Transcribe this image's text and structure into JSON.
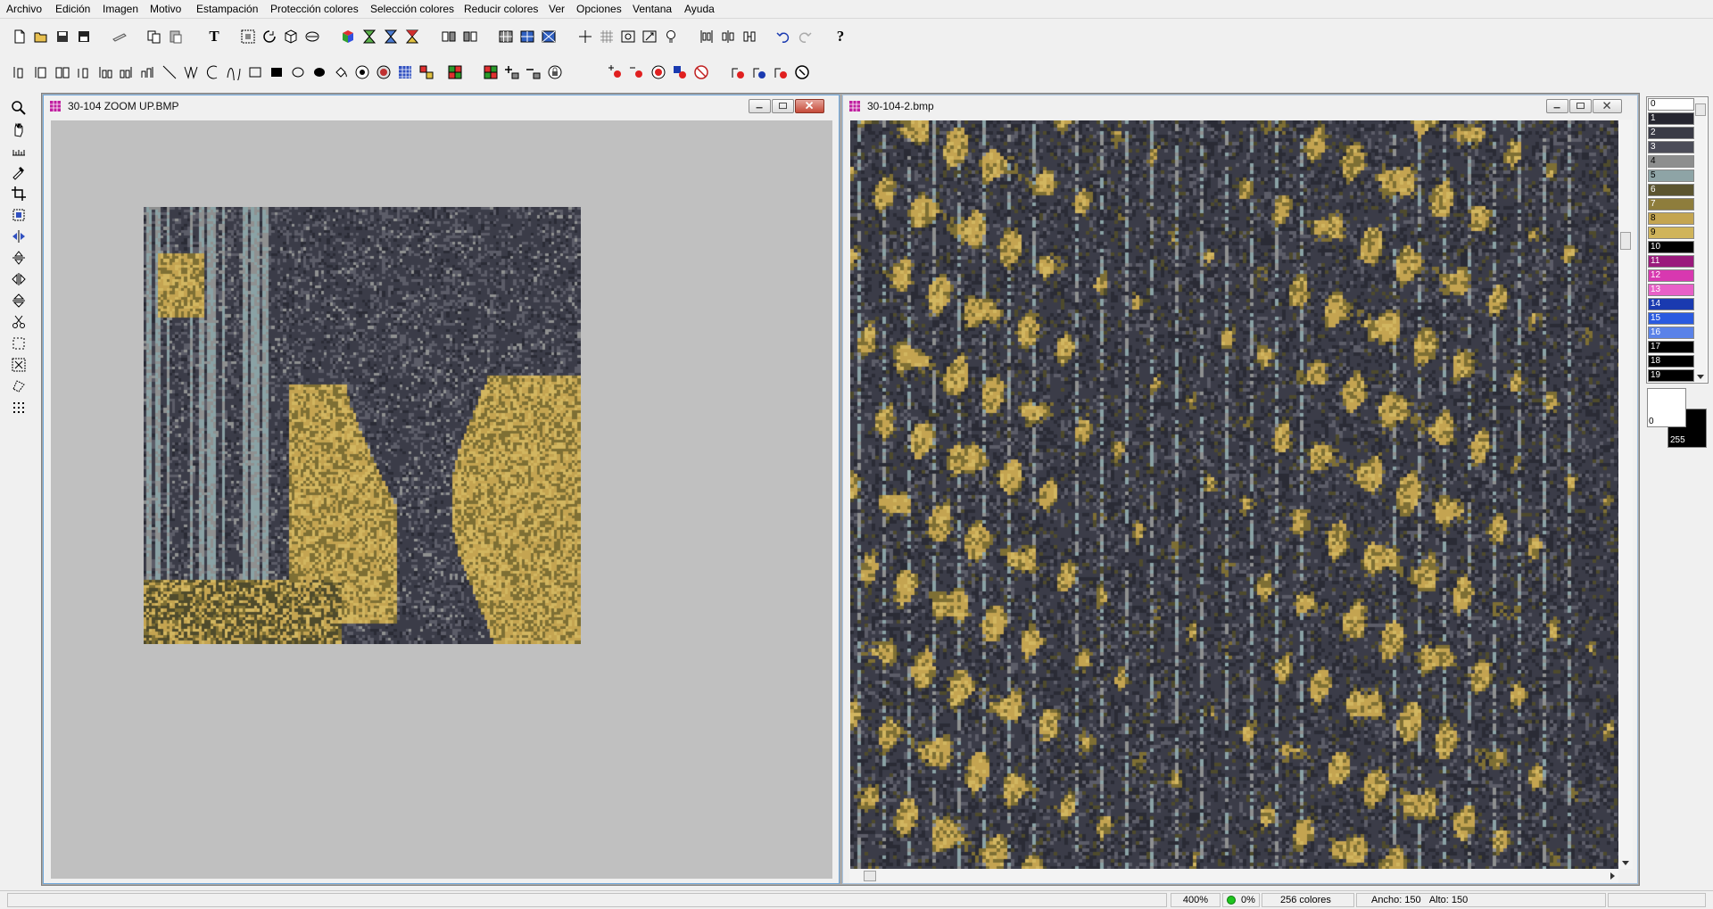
{
  "menu": [
    "Archivo",
    "Edición",
    "Imagen",
    "Motivo",
    "Estampación",
    "Protección colores",
    "Selección colores",
    "Reducir colores",
    "Ver",
    "Opciones",
    "Ventana",
    "Ayuda"
  ],
  "toolbar": {
    "text_tool_label": "T",
    "help_label": "?"
  },
  "windows": {
    "left": {
      "title": "30-104 ZOOM UP.BMP"
    },
    "right": {
      "title": "30-104-2.bmp"
    }
  },
  "palette": {
    "swatches": [
      {
        "index": "0",
        "color": "#ffffff"
      },
      {
        "index": "1",
        "color": "#262630"
      },
      {
        "index": "2",
        "color": "#3a3b46"
      },
      {
        "index": "3",
        "color": "#4b4c58"
      },
      {
        "index": "4",
        "color": "#8d8e8e"
      },
      {
        "index": "5",
        "color": "#8ea4a6"
      },
      {
        "index": "6",
        "color": "#5c5530"
      },
      {
        "index": "7",
        "color": "#8e7d3c"
      },
      {
        "index": "8",
        "color": "#c4a551"
      },
      {
        "index": "9",
        "color": "#d0b45a"
      },
      {
        "index": "10",
        "color": "#000000"
      },
      {
        "index": "11",
        "color": "#9a1a7c"
      },
      {
        "index": "12",
        "color": "#d838b0"
      },
      {
        "index": "13",
        "color": "#e860c8"
      },
      {
        "index": "14",
        "color": "#1a3ab0"
      },
      {
        "index": "15",
        "color": "#2a5ae0"
      },
      {
        "index": "16",
        "color": "#5a82e8"
      },
      {
        "index": "17",
        "color": "#000000"
      },
      {
        "index": "18",
        "color": "#000000"
      },
      {
        "index": "19",
        "color": "#000000"
      }
    ],
    "fg_index": "0",
    "bg_index": "255"
  },
  "status": {
    "zoom": "400%",
    "progress": "0%",
    "colors": "256 colores",
    "width": "Ancho: 150",
    "height": "Alto: 150"
  },
  "image_colors": {
    "dark": "#3b3c48",
    "darker": "#2a2b35",
    "mid_gray": "#5c5d68",
    "light_gray": "#8f9090",
    "teal_gray": "#8aa2a5",
    "olive_dark": "#4f4b2c",
    "olive": "#7e6f34",
    "gold": "#c4a451",
    "gold_light": "#d2b660"
  }
}
